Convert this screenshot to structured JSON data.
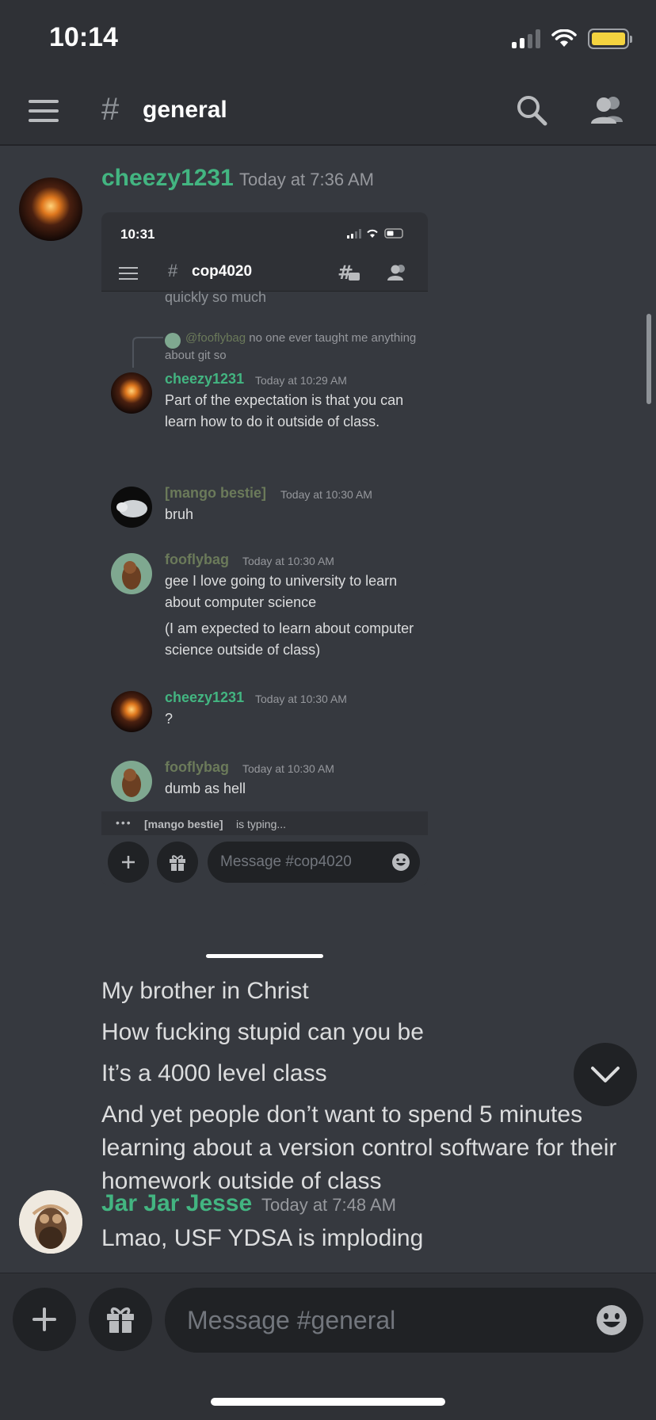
{
  "status": {
    "time": "10:14"
  },
  "header": {
    "channel": "general"
  },
  "messages": [
    {
      "user": "cheezy1231",
      "time": "Today at 7:36 AM",
      "lines": [
        "My brother in Christ",
        "How fucking stupid can you be",
        "It’s a 4000 level class",
        "And yet people don’t want to spend 5 minutes learning about a version control software for their homework outside of class"
      ]
    },
    {
      "user": "Jar Jar Jesse",
      "time": "Today at 7:48 AM",
      "text": "Lmao, USF YDSA is imploding"
    }
  ],
  "screenshot": {
    "time": "10:31",
    "channel": "cop4020",
    "partial_text": "quickly so much",
    "reply": {
      "mention": "@fooflybag",
      "text": "no one ever taught me anything about git so"
    },
    "posts": [
      {
        "user": "cheezy1231",
        "time": "Today at 10:29 AM",
        "text": "Part of the expectation is that you can learn how to do it outside of class.",
        "color": "#43b581"
      },
      {
        "user": "[mango bestie]",
        "time": "Today at 10:30 AM",
        "text": "bruh",
        "color": "#6b7a5a"
      },
      {
        "user": "fooflybag",
        "time": "Today at 10:30 AM",
        "text": "gee I love going to university to learn about computer science",
        "text2": "(I am expected to learn about computer science outside of class)",
        "color": "#6b7a5a"
      },
      {
        "user": "cheezy1231",
        "time": "Today at 10:30 AM",
        "text": "?",
        "color": "#43b581"
      },
      {
        "user": "fooflybag",
        "time": "Today at 10:30 AM",
        "text": "dumb as hell",
        "color": "#6b7a5a"
      }
    ],
    "typing_user": "[mango bestie]",
    "typing_suffix": "is typing...",
    "input_placeholder": "Message #cop4020"
  },
  "composer": {
    "placeholder": "Message #general"
  },
  "colors": {
    "accent_user": "#43b581",
    "background": "#36393f",
    "bar": "#2f3136"
  }
}
